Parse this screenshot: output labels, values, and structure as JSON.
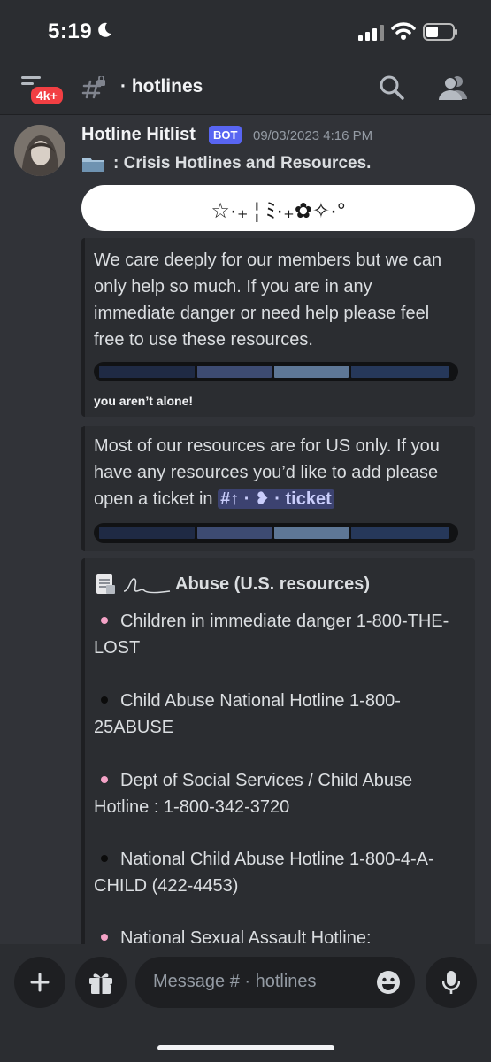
{
  "status_bar": {
    "time": "5:19"
  },
  "header": {
    "badge": "4k+",
    "channel": "· hotlines"
  },
  "message": {
    "author": "Hotline Hitlist",
    "bot_tag": "BOT",
    "timestamp": "09/03/2023 4:16 PM",
    "line": ": Crisis Hotlines and Resources.",
    "banner": "☆·₊ ¦ ﾐ·₊✿✧·°"
  },
  "embed1": {
    "text": "We care deeply for our members but we can only help so much. If you are in any immediate danger or need help please feel free to use these resources.",
    "caption": "you aren’t alone!"
  },
  "embed2": {
    "text_before": "Most of our resources are for US only. If you have any resources you’d like to add please open a ticket in",
    "mention": "#↑ · ❥ · ticket"
  },
  "embed3": {
    "title": "Abuse (U.S. resources)",
    "items": [
      {
        "text": "Children in immediate danger 1-800-THE-LOST",
        "bullet": "#f5a3c7"
      },
      {
        "text": "Child Abuse National Hotline 1-800-25ABUSE",
        "bullet": "#0b0b0b"
      },
      {
        "text": "Dept of Social Services / Child Abuse Hotline : 1-800-342-3720",
        "bullet": "#f5a3c7"
      },
      {
        "text": "National Child Abuse Hotline 1-800-4-A-CHILD (422-4453)",
        "bullet": "#0b0b0b"
      },
      {
        "text": "National Sexual Assault Hotline:",
        "bullet": "#f5a3c7"
      }
    ]
  },
  "composer": {
    "placeholder": "Message # · hotlines"
  },
  "colors": {
    "background": "#313338",
    "surface": "#2b2d31",
    "blurple": "#5865f2",
    "badge_red": "#f23f43",
    "stripe_colors": [
      "#1f2a44",
      "#3d4b72",
      "#5e7796",
      "#26385a"
    ]
  }
}
